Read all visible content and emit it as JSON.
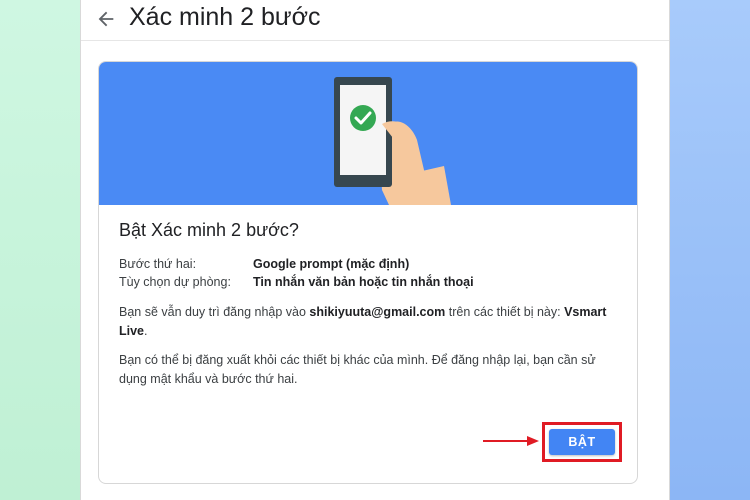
{
  "header": {
    "back_icon": "arrow-left-icon",
    "title": "Xác minh 2 bước"
  },
  "colors": {
    "hero_bg": "#4a8af4",
    "button_bg": "#4285f4",
    "highlight": "#e01b24",
    "check_green": "#34a853"
  },
  "card": {
    "illustration": "phone-with-checkmark-icon",
    "title": "Bật Xác minh 2 bước?",
    "details": [
      {
        "label": "Bước thứ hai:",
        "value": "Google prompt (mặc định)"
      },
      {
        "label": "Tùy chọn dự phòng:",
        "value": "Tin nhắn văn bản hoặc tin nhắn thoại"
      }
    ],
    "para1_pre": "Bạn sẽ vẫn duy trì đăng nhập vào ",
    "para1_email": "shikiyuuta@gmail.com",
    "para1_mid": " trên các thiết bị này: ",
    "para1_device": "Vsmart Live",
    "para1_end": ".",
    "para2": "Bạn có thể bị đăng xuất khỏi các thiết bị khác của mình. Để đăng nhập lại, bạn cần sử dụng mật khẩu và bước thứ hai.",
    "button_label": "BẬT"
  }
}
